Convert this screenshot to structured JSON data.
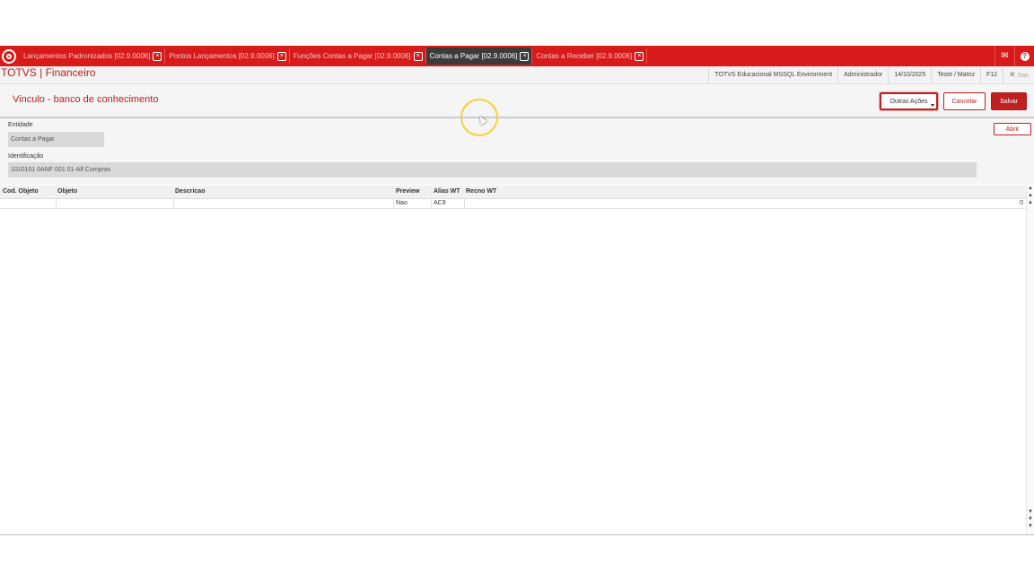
{
  "tabs": [
    {
      "label": "Lançamentos Padronizados [02.9.0006]",
      "active": false
    },
    {
      "label": "Pontos Lançamentos [02.9.0006]",
      "active": false
    },
    {
      "label": "Funções Contas a Pagar [02.9.0006]",
      "active": false
    },
    {
      "label": "Contas a Pagar [02.9.0006]",
      "active": true
    },
    {
      "label": "Contas a Receber [02.9.0006]",
      "active": false
    }
  ],
  "tab_close_glyph": "×",
  "topbar_icons": {
    "mail": "✉",
    "help": "?"
  },
  "app": {
    "title": "TOTVS | Financeiro",
    "environment": "TOTVS Educacional MSSQL Environment",
    "user": "Administrador",
    "date": "14/10/2025",
    "branch": "Teste / Matriz",
    "shortcut": "F12",
    "exit": "Sair",
    "exit_glyph": "✕"
  },
  "page": {
    "title": "Vinculo - banco de conhecimento",
    "outras_acoes": "Outras Ações",
    "cancelar": "Cancelar",
    "salvar": "Salvar"
  },
  "form": {
    "entidade_label": "Entidade",
    "entidade_value": "Contas a Pagar",
    "identificacao_label": "Identificação",
    "identificacao_value": "1010101  0ANF 001   01-Alf Compras",
    "abrir": "Abrir"
  },
  "grid": {
    "headers": [
      "Cod. Objeto",
      "Objeto",
      "Descricao",
      "Preview",
      "Alias WT",
      "Recno WT"
    ],
    "row": [
      "",
      "",
      "",
      "Nao",
      "AC9",
      "0"
    ]
  }
}
